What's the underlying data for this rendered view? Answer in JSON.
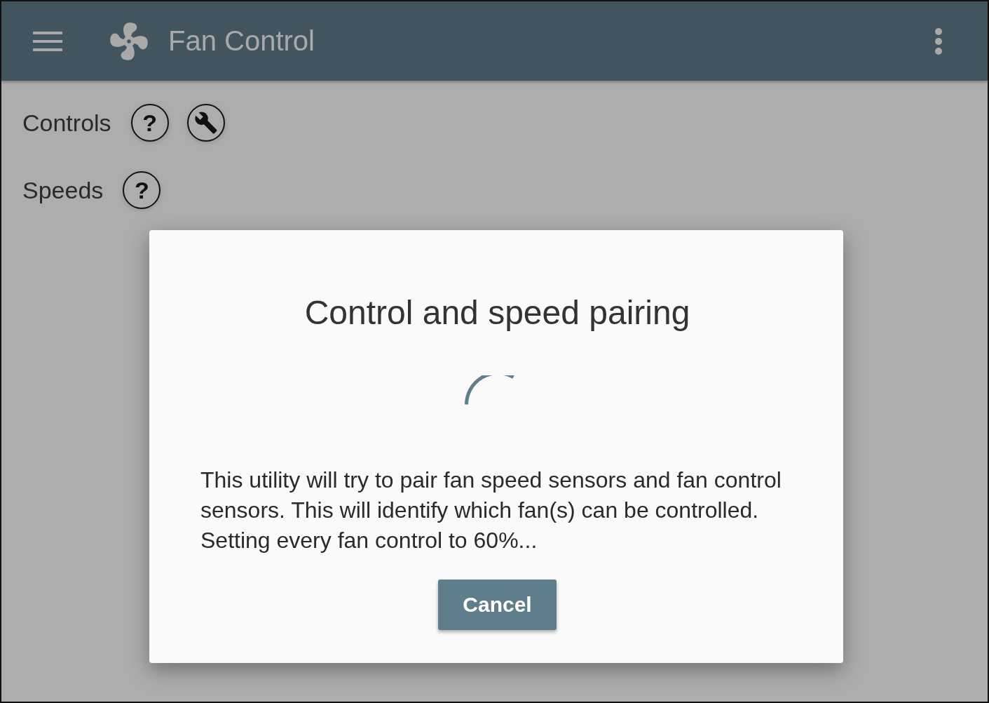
{
  "app_bar": {
    "title": "Fan Control"
  },
  "sections": [
    {
      "label": "Controls",
      "actions": [
        {
          "kind": "help",
          "text": "?"
        },
        {
          "kind": "wrench"
        }
      ]
    },
    {
      "label": "Speeds",
      "actions": [
        {
          "kind": "help",
          "text": "?"
        }
      ]
    }
  ],
  "dialog": {
    "title": "Control and speed pairing",
    "message": "This utility will try to pair fan speed sensors and fan control sensors. This will identify which fan(s) can be controlled. Setting every fan control to 60%...",
    "buttons": [
      "Cancel"
    ]
  }
}
